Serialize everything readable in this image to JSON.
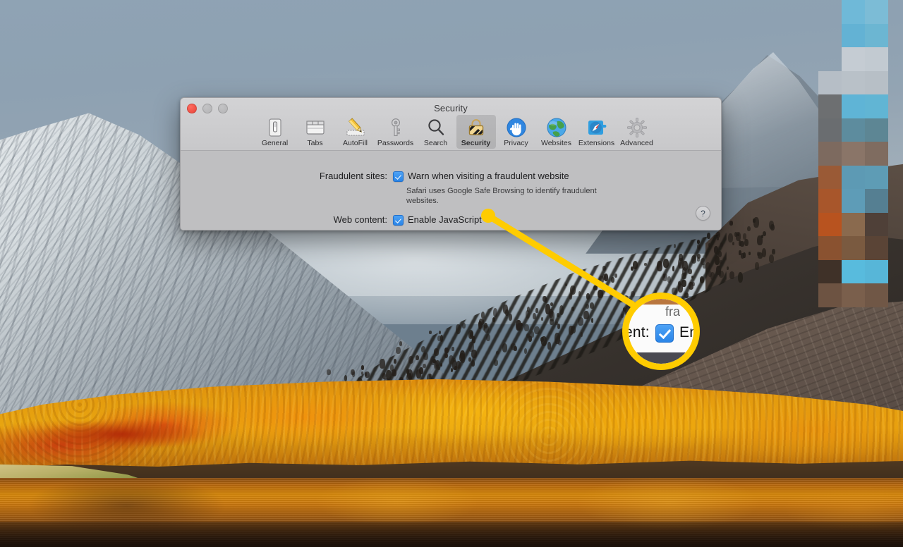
{
  "window": {
    "title": "Security",
    "traffic_lights": [
      "close",
      "minimize",
      "maximize"
    ],
    "help_button": "?"
  },
  "toolbar": {
    "items": [
      {
        "label": "General",
        "icon": "general-icon",
        "selected": false
      },
      {
        "label": "Tabs",
        "icon": "tabs-icon",
        "selected": false
      },
      {
        "label": "AutoFill",
        "icon": "autofill-icon",
        "selected": false
      },
      {
        "label": "Passwords",
        "icon": "passwords-icon",
        "selected": false
      },
      {
        "label": "Search",
        "icon": "search-icon",
        "selected": false
      },
      {
        "label": "Security",
        "icon": "security-icon",
        "selected": true
      },
      {
        "label": "Privacy",
        "icon": "privacy-icon",
        "selected": false
      },
      {
        "label": "Websites",
        "icon": "websites-icon",
        "selected": false
      },
      {
        "label": "Extensions",
        "icon": "extensions-icon",
        "selected": false
      },
      {
        "label": "Advanced",
        "icon": "advanced-icon",
        "selected": false
      }
    ]
  },
  "content": {
    "fraudulent_sites": {
      "label": "Fraudulent sites:",
      "checkbox_label": "Warn when visiting a fraudulent website",
      "checked": true,
      "help_text": "Safari uses Google Safe Browsing to identify fraudulent websites."
    },
    "web_content": {
      "label": "Web content:",
      "checkbox_label": "Enable JavaScript",
      "checked": true
    }
  },
  "callout": {
    "accent_color": "#FFCC00",
    "magnified_label_fragment": "ent:",
    "magnified_checkbox_checked": true,
    "magnified_text_fragment": "Enal",
    "magnified_faint_fragment": "fra"
  },
  "colors": {
    "window_bg": "#bfbfc1",
    "titlebar_bg": "#cecfd1",
    "checkbox_blue": "#2a85e8",
    "highlight_yellow": "#FFCC00"
  }
}
